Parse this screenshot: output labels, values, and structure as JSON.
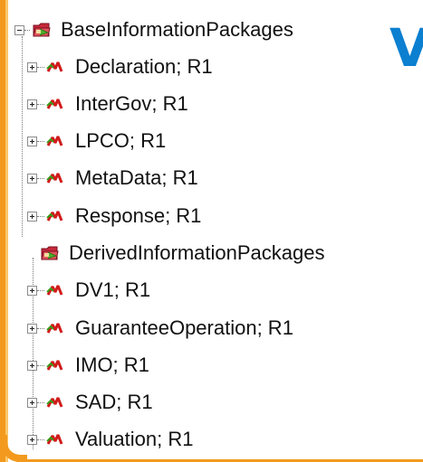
{
  "background_letter": "V",
  "tree": {
    "groups": [
      {
        "label": "BaseInformationPackages",
        "expanded": true,
        "icon": "package-icon",
        "items": [
          {
            "label": "Declaration; R1",
            "icon": "model-icon"
          },
          {
            "label": "InterGov; R1",
            "icon": "model-icon"
          },
          {
            "label": "LPCO; R1",
            "icon": "model-icon"
          },
          {
            "label": "MetaData; R1",
            "icon": "model-icon"
          },
          {
            "label": "Response; R1",
            "icon": "model-icon"
          }
        ]
      },
      {
        "label": "DerivedInformationPackages",
        "expanded": true,
        "icon": "package-icon",
        "items": [
          {
            "label": "DV1; R1",
            "icon": "model-icon"
          },
          {
            "label": "GuaranteeOperation; R1",
            "icon": "model-icon"
          },
          {
            "label": "IMO; R1",
            "icon": "model-icon"
          },
          {
            "label": "SAD; R1",
            "icon": "model-icon"
          },
          {
            "label": "Valuation; R1",
            "icon": "model-icon"
          }
        ]
      }
    ]
  },
  "colors": {
    "accent_orange": "#f39a1e",
    "letter_blue": "#0b7fd0",
    "icon_red": "#d11a1a",
    "icon_green": "#3a9a1a"
  }
}
